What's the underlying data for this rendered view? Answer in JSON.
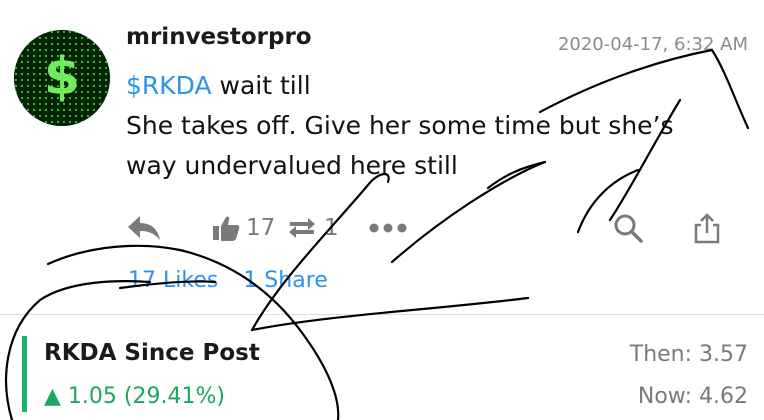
{
  "post": {
    "username": "mrinvestorpro",
    "timestamp": "2020-04-17, 6:32 AM",
    "ticker": "$RKDA",
    "text_line1_rest": " wait till",
    "text_line2": "She takes off. Give her some time but she’s",
    "text_line3": "way undervalued here still"
  },
  "actions": {
    "reply_icon": "reply-arrow-icon",
    "like_icon": "thumbs-up-icon",
    "like_count": "17",
    "reshare_icon": "reshare-icon",
    "reshare_count": "1",
    "more_icon": "more-dots-icon",
    "search_icon": "search-icon",
    "share_icon": "share-icon"
  },
  "engagement": {
    "likes": "17 Likes",
    "shares": "1 Share"
  },
  "stock": {
    "title": "RKDA Since Post",
    "change": "▲ 1.05 (29.41%)",
    "then": "Then: 3.57",
    "now": "Now: 4.62",
    "up_color": "#19a862"
  },
  "colors": {
    "link": "#2b93ee",
    "muted": "#7a7a7a"
  }
}
